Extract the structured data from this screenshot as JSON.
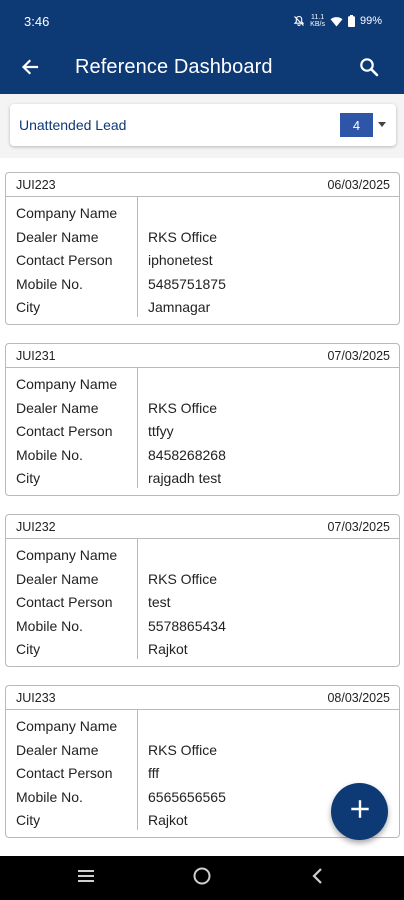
{
  "status_bar": {
    "time": "3:46",
    "data_speed_top": "11.1",
    "data_speed_bottom": "KB/s",
    "battery": "99%"
  },
  "app_bar": {
    "title": "Reference Dashboard",
    "back_icon": "arrow-left-icon",
    "search_icon": "search-icon"
  },
  "filter": {
    "selected": "Unattended Lead",
    "count": "4",
    "dropdown_icon": "caret-down-icon"
  },
  "labels": {
    "company": "Company Name",
    "dealer": "Dealer Name",
    "contact": "Contact Person",
    "mobile": "Mobile No.",
    "city": "City"
  },
  "leads": [
    {
      "id": "JUI223",
      "date": "06/03/2025",
      "company": "",
      "dealer": "RKS Office",
      "contact": "iphonetest",
      "mobile": "5485751875",
      "city": "Jamnagar"
    },
    {
      "id": "JUI231",
      "date": "07/03/2025",
      "company": "",
      "dealer": "RKS Office",
      "contact": "ttfyy",
      "mobile": "8458268268",
      "city": "rajgadh test"
    },
    {
      "id": "JUI232",
      "date": "07/03/2025",
      "company": "",
      "dealer": "RKS Office",
      "contact": "test",
      "mobile": "5578865434",
      "city": "Rajkot"
    },
    {
      "id": "JUI233",
      "date": "08/03/2025",
      "company": "",
      "dealer": "RKS Office",
      "contact": "fff",
      "mobile": "6565656565",
      "city": "Rajkot"
    }
  ],
  "fab": {
    "icon": "plus-icon"
  },
  "nav_bar": {
    "recents_icon": "recents-icon",
    "home_icon": "home-circle-icon",
    "back_icon": "nav-back-icon"
  },
  "colors": {
    "primary": "#0d3975",
    "count_badge": "#2e55a8",
    "card_border": "#b9b9b9"
  }
}
